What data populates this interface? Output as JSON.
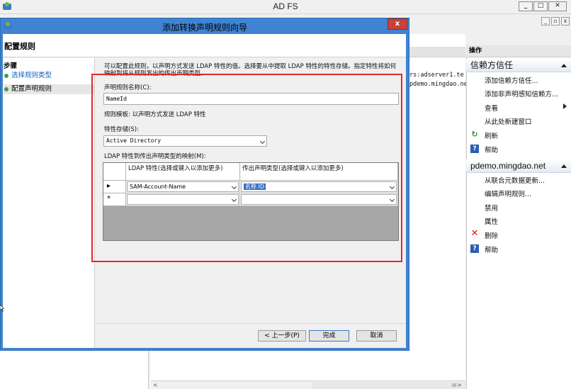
{
  "app": {
    "title": "AD FS"
  },
  "background": {
    "content_line1": "rs:adserver1.te",
    "content_line2": "pdemo.mingdao.ne",
    "scroll_label": "III"
  },
  "actions": {
    "header": "操作",
    "section1_title": "信赖方信任",
    "section1_items": [
      "添加信赖方信任...",
      "添加非声明感知信赖方...",
      "查看",
      "从此处新建窗口",
      "刷新",
      "帮助"
    ],
    "section2_title": "pdemo.mingdao.net",
    "section2_items": [
      "从联合元数据更新...",
      "编辑声明规则...",
      "禁用",
      "属性",
      "删除",
      "帮助"
    ]
  },
  "dialog": {
    "title": "添加转换声明规则向导",
    "close": "x",
    "heading": "配置规则",
    "steps_heading": "步骤",
    "steps": [
      "选择规则类型",
      "配置声明规则"
    ],
    "description": "可以配置此规则，以声明方式发送 LDAP 特性的值。选择要从中提取 LDAP 特性的特性存储。指定特性将如何映射到将从规则发出的传出声明类型。",
    "rule_name_label": "声明规则名称(C):",
    "rule_name_value": "NameId",
    "template_text": "规则模板: 以声明方式发送 LDAP 特性",
    "store_label": "特性存储(S):",
    "store_value": "Active Directory",
    "mapping_label": "LDAP 特性到传出声明类型的映射(M):",
    "grid": {
      "col1_header": "LDAP 特性(选择或键入以添加更多)",
      "col2_header": "传出声明类型(选择或键入以添加更多)",
      "rows": [
        {
          "marker": "▸",
          "ldap": "SAM-Account-Name",
          "claim": "名称 ID"
        },
        {
          "marker": "*",
          "ldap": "",
          "claim": ""
        }
      ]
    },
    "buttons": {
      "back": "< 上一步(P)",
      "finish": "完成",
      "cancel": "取消"
    }
  },
  "colors": {
    "accent": "#3f83d2",
    "highlight": "#e02a2a"
  }
}
